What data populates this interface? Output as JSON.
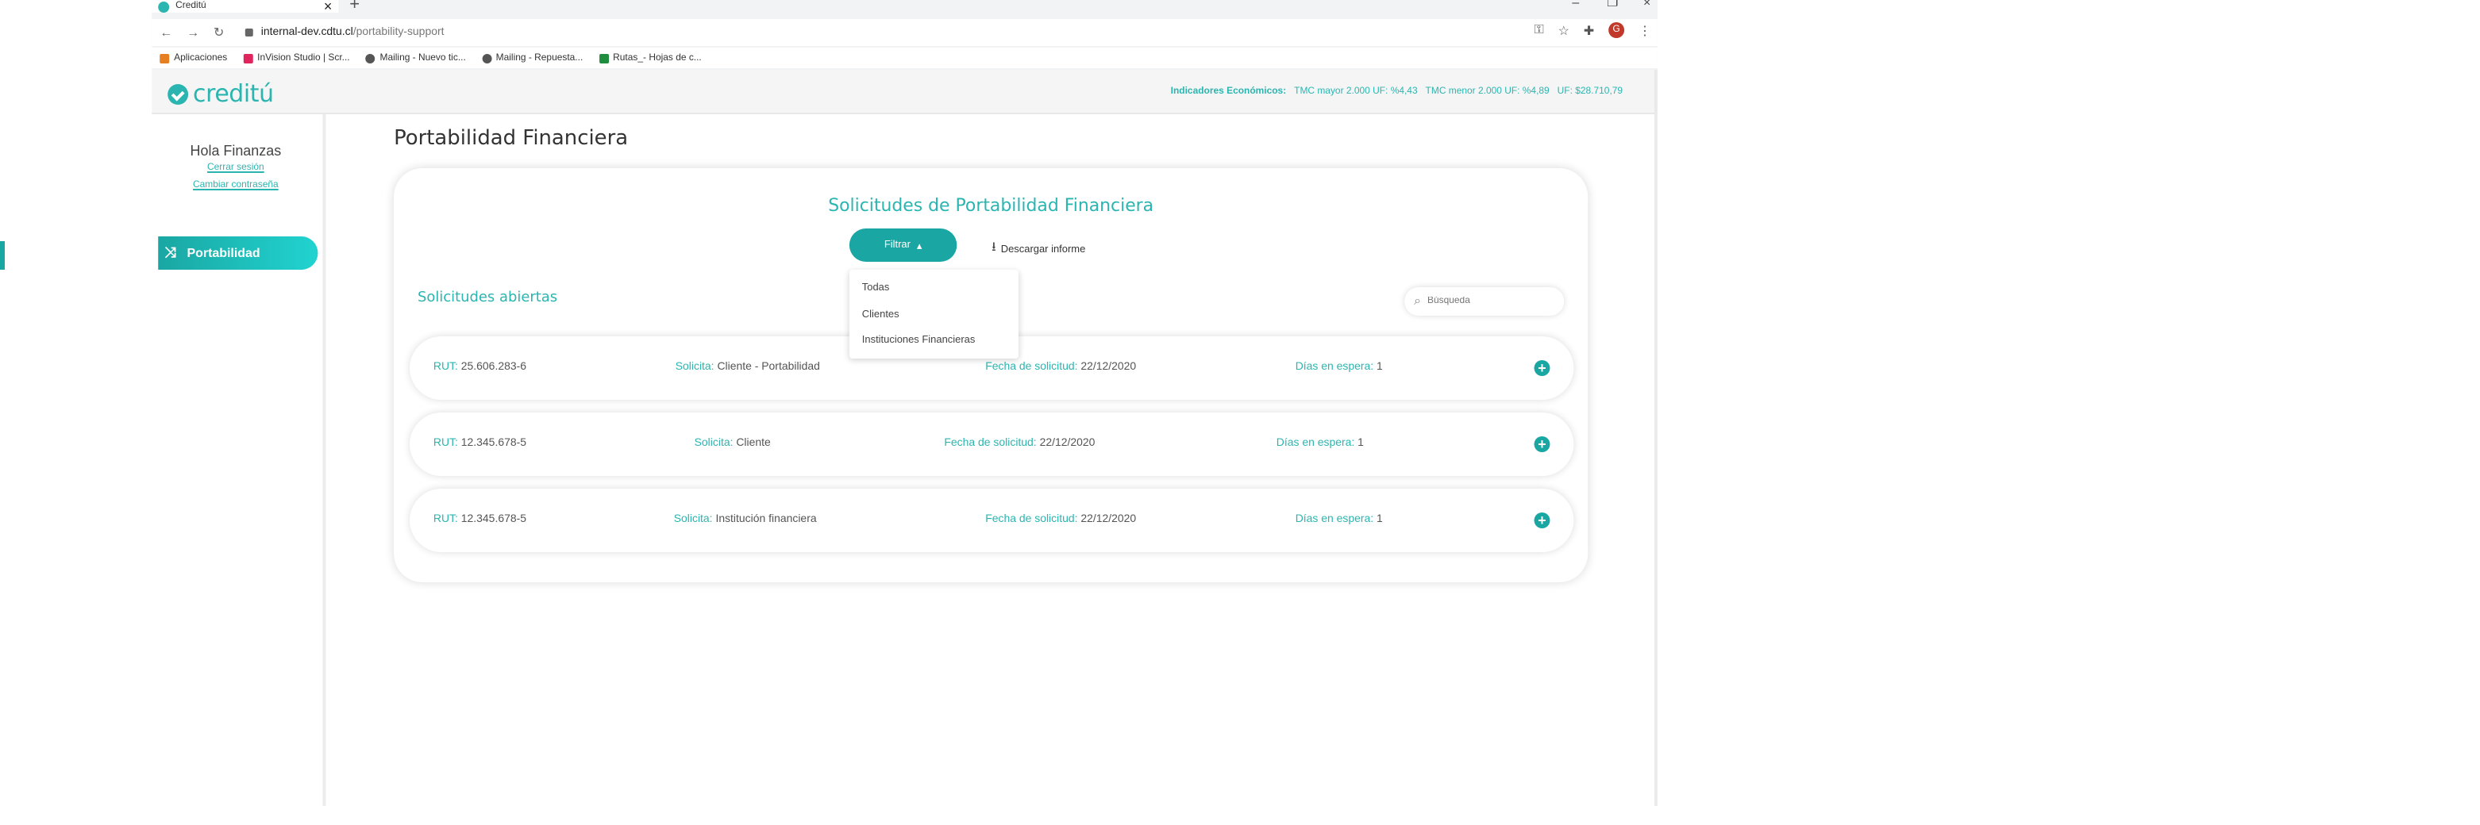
{
  "browser": {
    "tab_title": "Creditú",
    "tab_close": "×",
    "new_tab": "+",
    "url_host": "internal-dev.cdtu.cl",
    "url_path": "/portability-support",
    "profile_initial": "G",
    "nav_back": "←",
    "nav_forward": "→",
    "nav_reload": "↻",
    "win_min": "–",
    "win_max": "❐",
    "win_close": "×",
    "bookmarks": [
      {
        "label": "Aplicaciones",
        "icon": "apps-grid-icon",
        "color": "#e67e22"
      },
      {
        "label": "InVision Studio | Scr...",
        "icon": "invision-icon",
        "color": "#e0245e"
      },
      {
        "label": "Mailing - Nuevo tic...",
        "icon": "globe-icon",
        "color": "#555555"
      },
      {
        "label": "Mailing - Repuesta...",
        "icon": "globe-icon",
        "color": "#555555"
      },
      {
        "label": "Rutas_- Hojas de c...",
        "icon": "sheets-icon",
        "color": "#1e8e3e"
      }
    ]
  },
  "header": {
    "brand": "creditú",
    "indicators_label": "Indicadores Económicos:",
    "indicators": [
      "TMC mayor 2.000 UF: %4,43",
      "TMC menor 2.000 UF: %4,89",
      "UF: $28.710,79"
    ]
  },
  "sidebar": {
    "greeting": "Hola Finanzas",
    "logout": "Cerrar sesión",
    "change_password": "Cambiar contraseña",
    "nav_item": "Portabilidad"
  },
  "page": {
    "title": "Portabilidad Financiera",
    "card_title": "Solicitudes de Portabilidad Financiera",
    "filter_button": "Filtrar",
    "download": "Descargar informe",
    "filter_options": [
      "Todas",
      "Clientes",
      "Instituciones Financieras"
    ],
    "open_requests": "Solicitudes abiertas",
    "search_placeholder": "Búsqueda"
  },
  "labels": {
    "rut": "RUT:",
    "solicita": "Solicita:",
    "fecha": "Fecha de solicitud:",
    "dias": "Días en espera:"
  },
  "requests": [
    {
      "rut": "25.606.283-6",
      "solicita": "Cliente - Portabilidad",
      "fecha": "22/12/2020",
      "dias": "1"
    },
    {
      "rut": "12.345.678-5",
      "solicita": "Cliente",
      "fecha": "22/12/2020",
      "dias": "1"
    },
    {
      "rut": "12.345.678-5",
      "solicita": "Institución financiera",
      "fecha": "22/12/2020",
      "dias": "1"
    }
  ],
  "colors": {
    "accent": "#2bb5b0",
    "accent_dark": "#1aa7a3"
  }
}
